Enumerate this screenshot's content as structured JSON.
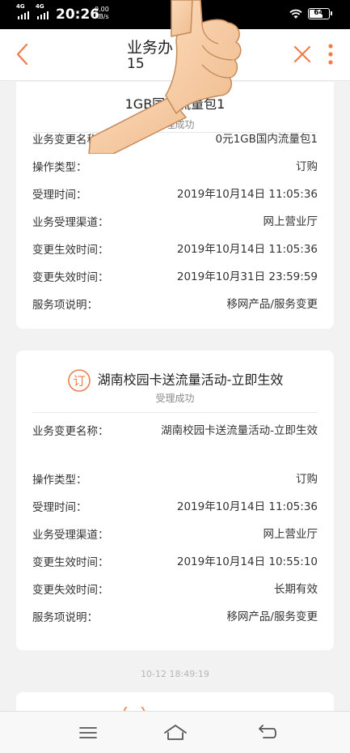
{
  "status_bar": {
    "signal1_tag": "4G",
    "signal2_tag": "4G",
    "time": "20:26",
    "net_speed": "0.00",
    "net_unit": "KB/s",
    "battery": "64"
  },
  "header": {
    "title": "业务办",
    "subtitle": "15"
  },
  "card1": {
    "title": "1GB国内流量包1",
    "status": "受理成功",
    "rows": [
      {
        "label": "业务变更名称：",
        "value": "0元1GB国内流量包1"
      },
      {
        "label": "操作类型：",
        "value": "订购"
      },
      {
        "label": "受理时间：",
        "value": "2019年10月14日 11:05:36"
      },
      {
        "label": "业务受理渠道：",
        "value": "网上营业厅"
      },
      {
        "label": "变更生效时间：",
        "value": "2019年10月14日 11:05:36"
      },
      {
        "label": "变更失效时间：",
        "value": "2019年10月31日 23:59:59"
      },
      {
        "label": "服务项说明：",
        "value": "移网产品/服务变更"
      }
    ]
  },
  "card2": {
    "icon_char": "订",
    "title": "湖南校园卡送流量活动-立即生效",
    "status": "受理成功",
    "rows": [
      {
        "label": "业务变更名称：",
        "value": "湖南校园卡送流量活动-立即生效"
      },
      {
        "label": "操作类型：",
        "value": "订购"
      },
      {
        "label": "受理时间：",
        "value": "2019年10月14日 11:05:36"
      },
      {
        "label": "业务受理渠道：",
        "value": "网上营业厅"
      },
      {
        "label": "变更生效时间：",
        "value": "2019年10月14日 10:55:10"
      },
      {
        "label": "变更失效时间：",
        "value": "长期有效"
      },
      {
        "label": "服务项说明：",
        "value": "移网产品/服务变更"
      }
    ]
  },
  "timestamp": "10-12 18:49:19",
  "colors": {
    "accent": "#ee7d4a",
    "text": "#333333",
    "muted": "#8a8a8a",
    "background": "#f2f2f2"
  },
  "icons": {
    "back": "chevron-left-icon",
    "close": "close-icon",
    "more": "more-vertical-icon",
    "order": "order-badge-icon",
    "nav_menu": "menu-icon",
    "nav_home": "home-icon",
    "nav_back": "back-arrow-icon",
    "overlay": "thumbs-up-icon"
  }
}
